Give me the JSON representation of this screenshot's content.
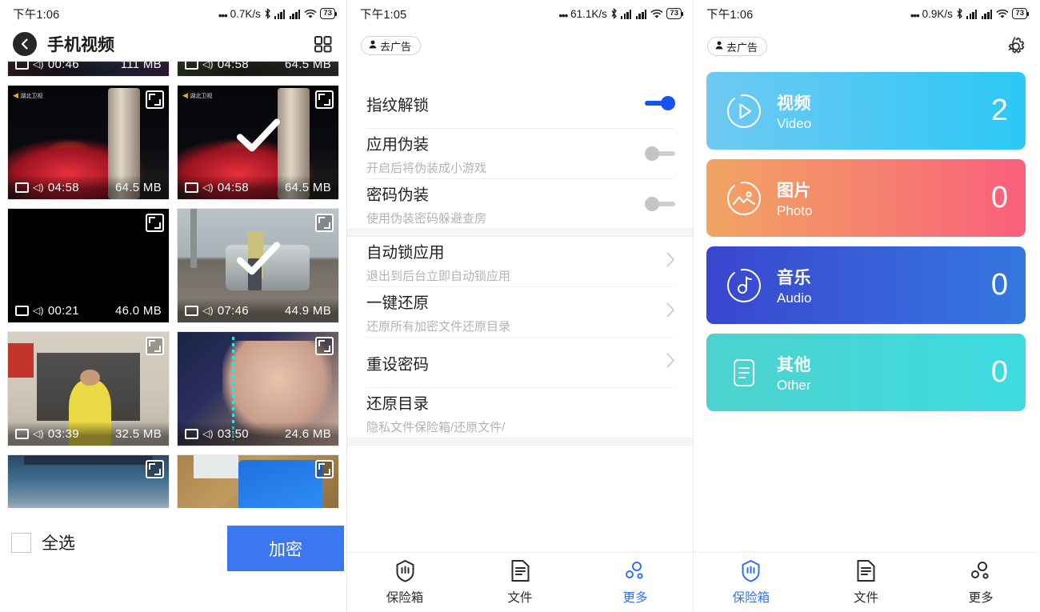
{
  "panels": {
    "left": {
      "statusbar": {
        "time": "下午1:06",
        "dots": "•••",
        "speed": "0.7K/s",
        "bluetooth": "bluetooth-icon",
        "battery": "73"
      },
      "header": {
        "back": "back-icon",
        "title": "手机视频",
        "grid": "grid-view-icon"
      },
      "videos": [
        {
          "duration": "00:46",
          "size": "111 MB",
          "selected": false,
          "clip": "top"
        },
        {
          "duration": "04:58",
          "size": "64.5 MB",
          "selected": false,
          "clip": "top"
        },
        {
          "duration": "04:58",
          "size": "64.5 MB",
          "selected": false,
          "clip": "none"
        },
        {
          "duration": "04:58",
          "size": "64.5 MB",
          "selected": true,
          "clip": "none"
        },
        {
          "duration": "00:21",
          "size": "46.0 MB",
          "selected": false,
          "clip": "none"
        },
        {
          "duration": "07:46",
          "size": "44.9 MB",
          "selected": true,
          "clip": "none"
        },
        {
          "duration": "03:39",
          "size": "32.5 MB",
          "selected": false,
          "clip": "none"
        },
        {
          "duration": "03:50",
          "size": "24.6 MB",
          "selected": false,
          "clip": "none"
        },
        {
          "duration": "",
          "size": "",
          "selected": false,
          "clip": "bottom"
        },
        {
          "duration": "",
          "size": "",
          "selected": false,
          "clip": "bottom"
        }
      ],
      "bottom": {
        "select_all": "全选",
        "encrypt": "加密",
        "encrypt_color": "#3b78f0"
      }
    },
    "middle": {
      "statusbar": {
        "time": "下午1:05",
        "dots": "•••",
        "speed": "61.1K/s",
        "battery": "73"
      },
      "ad_pill": {
        "label": "去广告",
        "icon": "person-icon"
      },
      "settings": [
        {
          "title": "指纹解锁",
          "subtitle": "",
          "control": "switch",
          "state": "on"
        },
        {
          "title": "应用伪装",
          "subtitle": "开启后将伪装成小游戏",
          "control": "switch",
          "state": "off"
        },
        {
          "title": "密码伪装",
          "subtitle": "使用伪装密码躲避查房",
          "control": "switch",
          "state": "off"
        },
        {
          "title": "自动锁应用",
          "subtitle": "退出到后台立即自动锁应用",
          "control": "chevron",
          "state": ""
        },
        {
          "title": "一键还原",
          "subtitle": "还原所有加密文件还原目录",
          "control": "chevron",
          "state": ""
        },
        {
          "title": "重设密码",
          "subtitle": "",
          "control": "chevron",
          "state": ""
        },
        {
          "title": "还原目录",
          "subtitle": "隐私文件保险箱/还原文件/",
          "control": "none",
          "state": ""
        }
      ],
      "tabs": [
        {
          "label": "保险箱",
          "icon": "shield-icon",
          "active": false
        },
        {
          "label": "文件",
          "icon": "document-icon",
          "active": false
        },
        {
          "label": "更多",
          "icon": "more-icon",
          "active": true
        }
      ]
    },
    "right": {
      "statusbar": {
        "time": "下午1:06",
        "dots": "•••",
        "speed": "0.9K/s",
        "battery": "73"
      },
      "ad_pill": {
        "label": "去广告",
        "icon": "person-icon"
      },
      "gear": "gear-icon",
      "cards": [
        {
          "name_cn": "视频",
          "name_en": "Video",
          "count": "2",
          "icon": "play-circle-icon",
          "from": "#6fc9f2",
          "to": "#2cc8f5"
        },
        {
          "name_cn": "图片",
          "name_en": "Photo",
          "count": "0",
          "icon": "image-circle-icon",
          "from": "#f2a463",
          "to": "#fa5f7c"
        },
        {
          "name_cn": "音乐",
          "name_en": "Audio",
          "count": "0",
          "icon": "music-circle-icon",
          "from": "#3a46cf",
          "to": "#3577e0"
        },
        {
          "name_cn": "其他",
          "name_en": "Other",
          "count": "0",
          "icon": "note-icon",
          "from": "#4dd3cf",
          "to": "#3ddbe0"
        }
      ],
      "tabs": [
        {
          "label": "保险箱",
          "icon": "shield-icon",
          "active": true
        },
        {
          "label": "文件",
          "icon": "document-icon",
          "active": false
        },
        {
          "label": "更多",
          "icon": "more-icon",
          "active": false
        }
      ]
    }
  }
}
